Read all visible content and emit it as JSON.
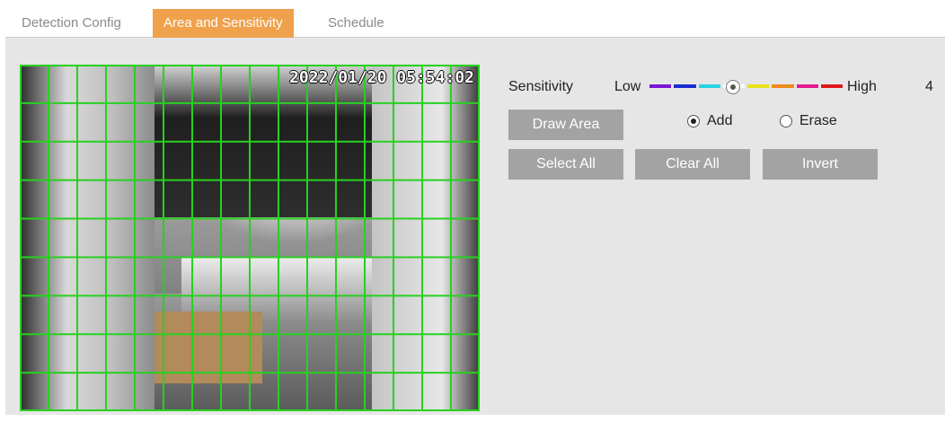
{
  "tabs": [
    {
      "label": "Detection Config",
      "active": false
    },
    {
      "label": "Area and Sensitivity",
      "active": true
    },
    {
      "label": "Schedule",
      "active": false
    }
  ],
  "video": {
    "timestamp": "2022/01/20 05:54:02",
    "grid_color": "#27d11f",
    "grid_columns": 16,
    "grid_rows": 9
  },
  "sensitivity": {
    "label": "Sensitivity",
    "low_label": "Low",
    "high_label": "High",
    "value": "4",
    "segment_colors": [
      "#7a16d6",
      "#1c2bd6",
      "#27d3e4",
      "#ffffff",
      "#e9e31c",
      "#f08a1d",
      "#e31b8f",
      "#e0181b"
    ],
    "knob_icon": "slider-knob-icon"
  },
  "actions": {
    "draw_area": "Draw Area",
    "select_all": "Select All",
    "clear_all": "Clear All",
    "invert": "Invert"
  },
  "mode": {
    "add_label": "Add",
    "erase_label": "Erase",
    "selected": "Add"
  }
}
